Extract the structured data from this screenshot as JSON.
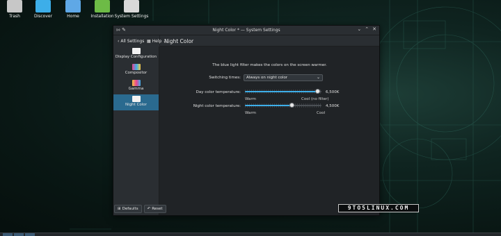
{
  "desktop": {
    "icons": [
      {
        "label": "Trash",
        "color": "#c7c7c7"
      },
      {
        "label": "Discover",
        "color": "#3daee9"
      },
      {
        "label": "Home",
        "color": "#5fa8e6"
      },
      {
        "label": "Installation",
        "color": "#6dbb46"
      },
      {
        "label": "System Settings",
        "color": "#d8d8d8"
      }
    ]
  },
  "window": {
    "title": "Night Color * — System Settings",
    "toolbar": {
      "back_label": "All Settings",
      "help_label": "Help"
    },
    "sidebar": {
      "items": [
        {
          "label": "Display Configuration",
          "icon": "monitor-icon"
        },
        {
          "label": "Compositor",
          "icon": "compositor-icon"
        },
        {
          "label": "Gamma",
          "icon": "gamma-icon"
        },
        {
          "label": "Night Color",
          "icon": "night-color-icon",
          "active": true
        }
      ],
      "defaults_label": "Defaults",
      "reset_label": "Reset"
    },
    "page": {
      "title": "Night Color",
      "description": "The blue light filter makes the colors on the screen warmer.",
      "switching_label": "Switching times:",
      "switching_value": "Always on night color",
      "day": {
        "label": "Day color temperature:",
        "value": "6,500K",
        "position": 0.98,
        "min_label": "Warm",
        "max_label": "Cool (no filter)"
      },
      "night": {
        "label": "Night color temperature:",
        "value": "4,500K",
        "position": 0.62,
        "min_label": "Warm",
        "max_label": "Cool"
      }
    }
  },
  "watermark": "9TO5LINUX.COM",
  "accent": "#3daee9",
  "active_item_color": "#2a6a8f"
}
